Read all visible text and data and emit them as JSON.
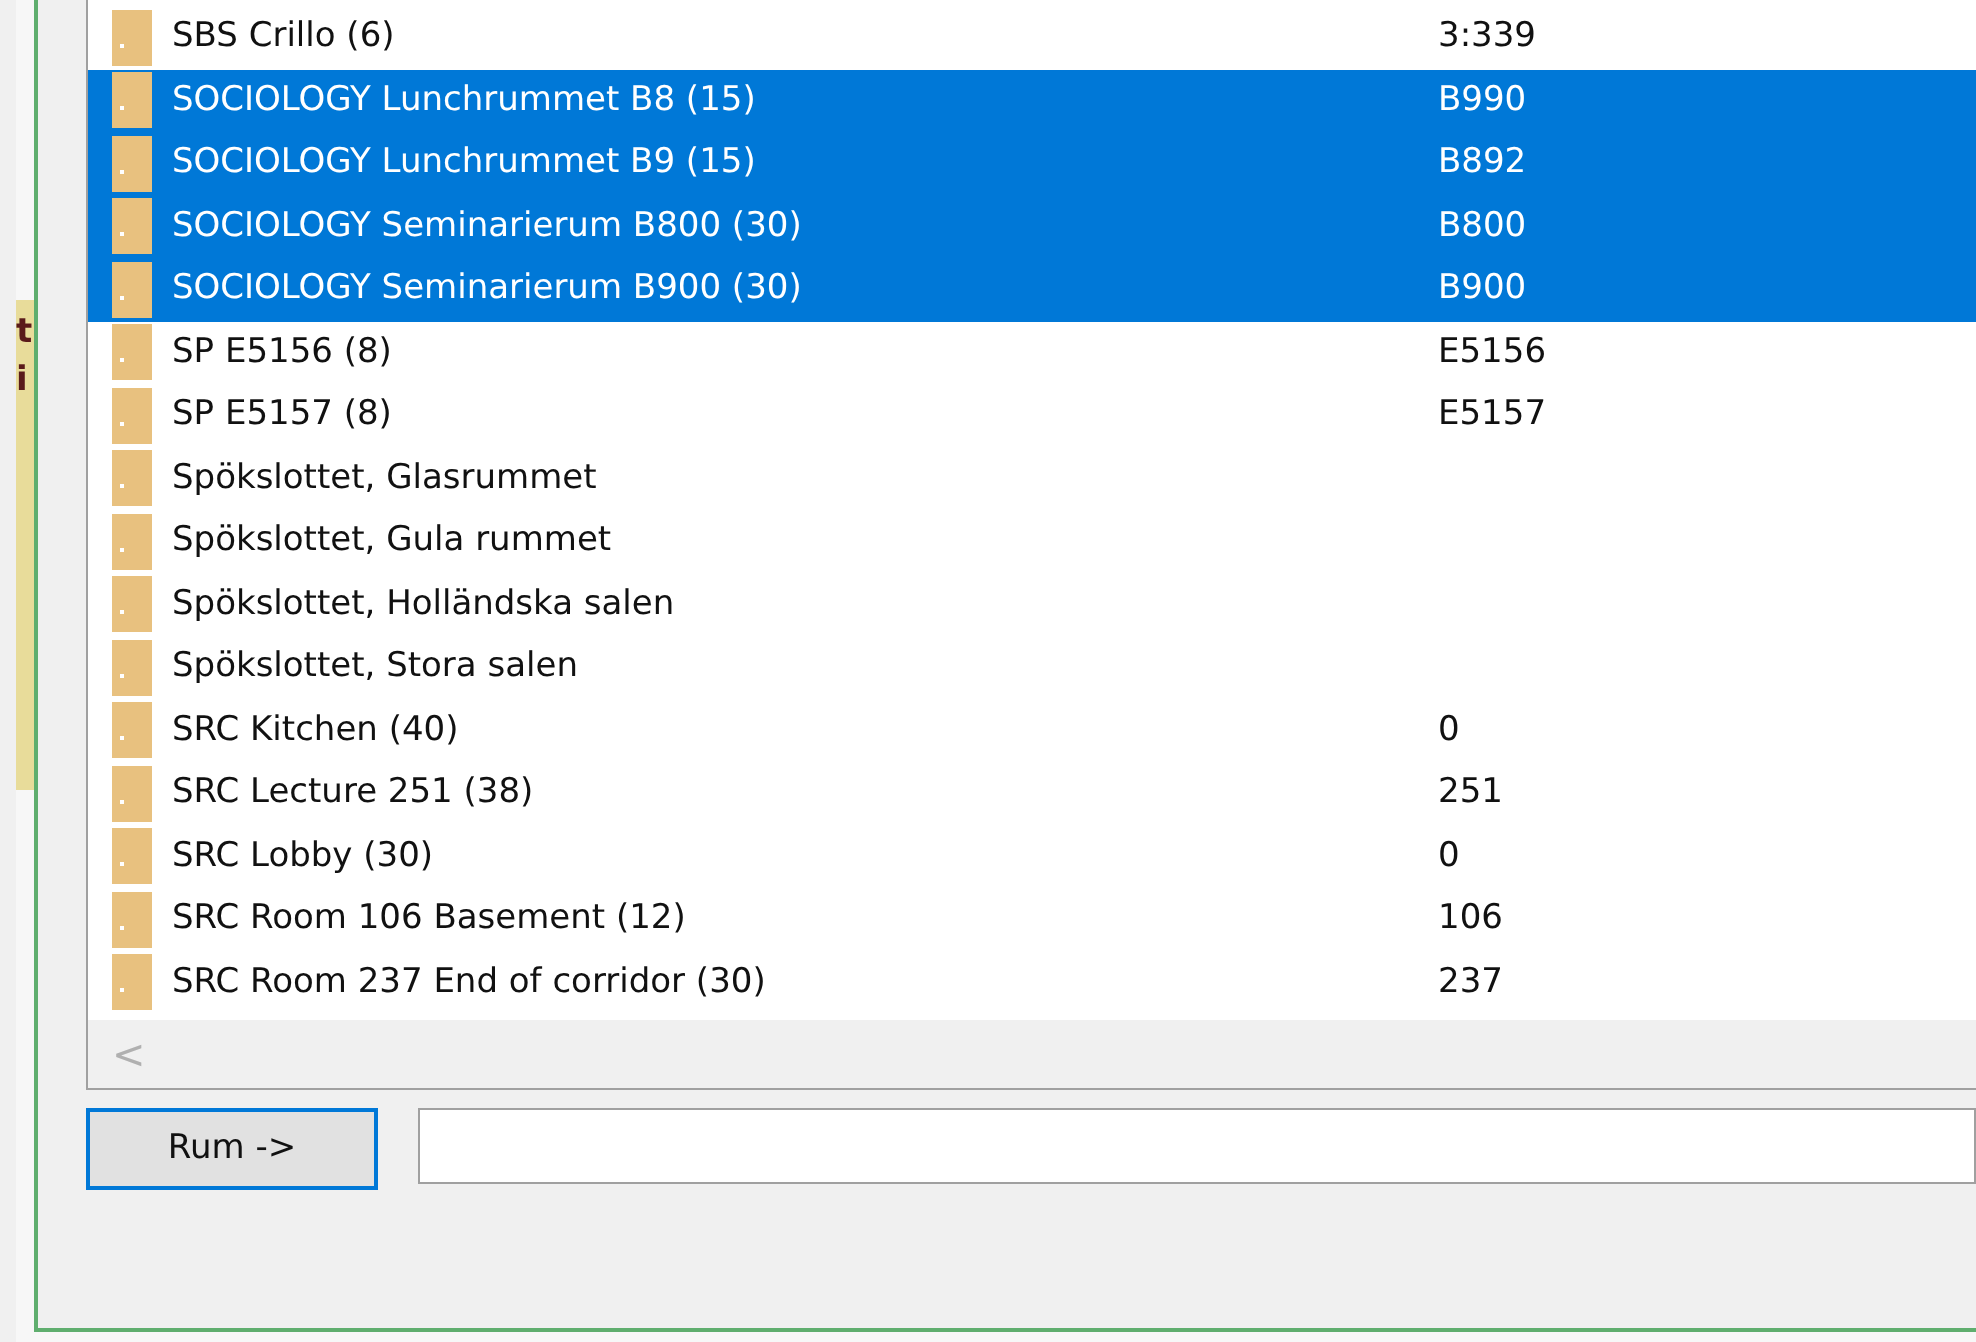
{
  "side_panel": {
    "lines": [
      "t",
      "i"
    ]
  },
  "list": {
    "rows": [
      {
        "name": "SBS Crillo (6)",
        "code": "3:339",
        "selected": false
      },
      {
        "name": "SOCIOLOGY Lunchrummet B8 (15)",
        "code": "B990",
        "selected": true
      },
      {
        "name": "SOCIOLOGY Lunchrummet B9 (15)",
        "code": "B892",
        "selected": true
      },
      {
        "name": "SOCIOLOGY Seminarierum B800 (30)",
        "code": "B800",
        "selected": true
      },
      {
        "name": "SOCIOLOGY Seminarierum B900 (30)",
        "code": "B900",
        "selected": true
      },
      {
        "name": "SP E5156 (8)",
        "code": "E5156",
        "selected": false
      },
      {
        "name": "SP E5157 (8)",
        "code": "E5157",
        "selected": false
      },
      {
        "name": "Spökslottet, Glasrummet",
        "selected": false
      },
      {
        "name": "Spökslottet, Gula rummet",
        "selected": false
      },
      {
        "name": "Spökslottet, Holländska salen",
        "selected": false
      },
      {
        "name": "Spökslottet, Stora salen",
        "selected": false
      },
      {
        "name": "SRC Kitchen (40)",
        "code": "0",
        "selected": false
      },
      {
        "name": "SRC Lecture 251 (38)",
        "code": "251",
        "selected": false
      },
      {
        "name": "SRC Lobby (30)",
        "code": "0",
        "selected": false
      },
      {
        "name": "SRC Room 106 Basement (12)",
        "code": "106",
        "selected": false
      },
      {
        "name": "SRC Room 237 End of corridor (30)",
        "code": "237",
        "selected": false
      }
    ]
  },
  "scroll_left": "<",
  "button": "Rum ->"
}
